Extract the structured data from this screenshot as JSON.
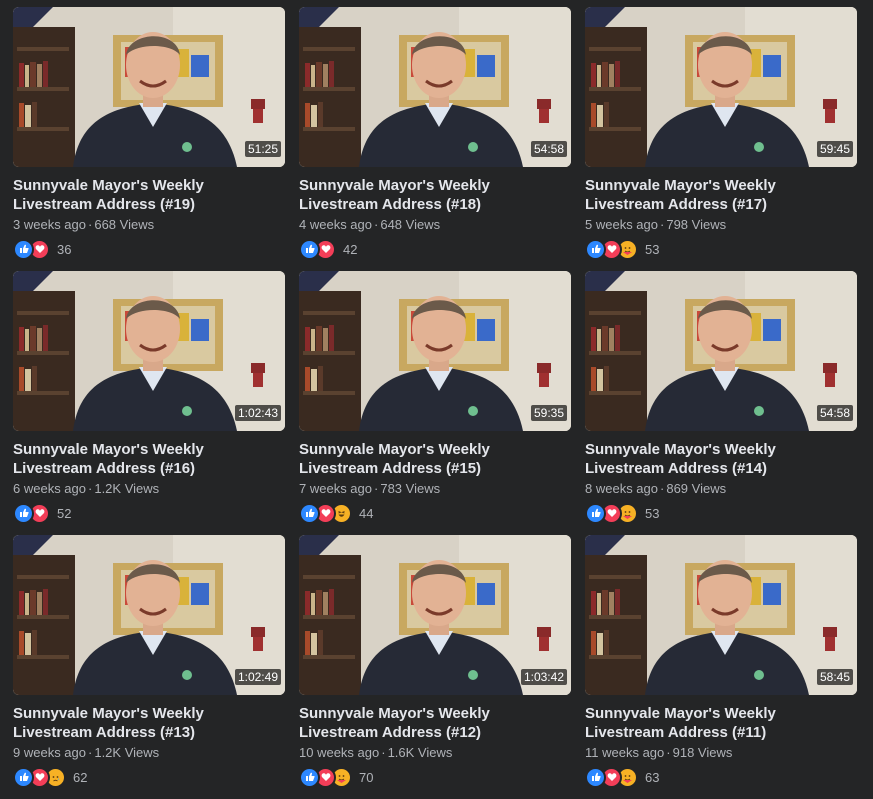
{
  "colors": {
    "background": "#242526",
    "title": "#e4e6eb",
    "meta": "#b0b3b8",
    "like": "#2d88ff",
    "love": "#f33e58",
    "emoji": "#f7b125"
  },
  "videos": [
    {
      "title": "Sunnyvale Mayor's Weekly Livestream Address (#19)",
      "age": "3 weeks ago",
      "views": "668 Views",
      "duration": "51:25",
      "reaction_count": "36",
      "reactions": [
        "like-icon",
        "love-icon"
      ]
    },
    {
      "title": "Sunnyvale Mayor's Weekly Livestream Address (#18)",
      "age": "4 weeks ago",
      "views": "648 Views",
      "duration": "54:58",
      "reaction_count": "42",
      "reactions": [
        "like-icon",
        "love-icon"
      ]
    },
    {
      "title": "Sunnyvale Mayor's Weekly Livestream Address (#17)",
      "age": "5 weeks ago",
      "views": "798 Views",
      "duration": "59:45",
      "reaction_count": "53",
      "reactions": [
        "like-icon",
        "love-icon",
        "care-icon"
      ]
    },
    {
      "title": "Sunnyvale Mayor's Weekly Livestream Address (#16)",
      "age": "6 weeks ago",
      "views": "1.2K Views",
      "duration": "1:02:43",
      "reaction_count": "52",
      "reactions": [
        "like-icon",
        "love-icon"
      ]
    },
    {
      "title": "Sunnyvale Mayor's Weekly Livestream Address (#15)",
      "age": "7 weeks ago",
      "views": "783 Views",
      "duration": "59:35",
      "reaction_count": "44",
      "reactions": [
        "like-icon",
        "love-icon",
        "haha-icon"
      ]
    },
    {
      "title": "Sunnyvale Mayor's Weekly Livestream Address (#14)",
      "age": "8 weeks ago",
      "views": "869 Views",
      "duration": "54:58",
      "reaction_count": "53",
      "reactions": [
        "like-icon",
        "love-icon",
        "care-icon"
      ]
    },
    {
      "title": "Sunnyvale Mayor's Weekly Livestream Address (#13)",
      "age": "9 weeks ago",
      "views": "1.2K Views",
      "duration": "1:02:49",
      "reaction_count": "62",
      "reactions": [
        "like-icon",
        "love-icon",
        "sad-icon"
      ]
    },
    {
      "title": "Sunnyvale Mayor's Weekly Livestream Address (#12)",
      "age": "10 weeks ago",
      "views": "1.6K Views",
      "duration": "1:03:42",
      "reaction_count": "70",
      "reactions": [
        "like-icon",
        "love-icon",
        "care-icon"
      ]
    },
    {
      "title": "Sunnyvale Mayor's Weekly Livestream Address (#11)",
      "age": "11 weeks ago",
      "views": "918 Views",
      "duration": "58:45",
      "reaction_count": "63",
      "reactions": [
        "like-icon",
        "love-icon",
        "care-icon"
      ]
    }
  ]
}
